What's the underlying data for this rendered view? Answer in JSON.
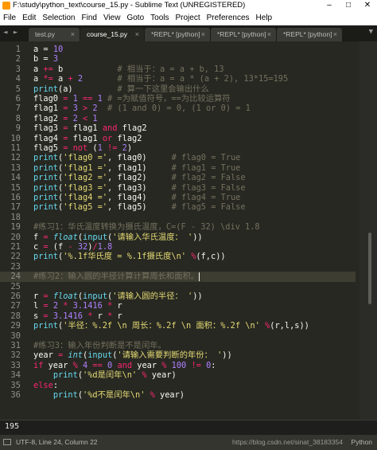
{
  "titlebar": {
    "text": "F:\\study\\python_text\\course_15.py - Sublime Text (UNREGISTERED)",
    "min": "–",
    "max": "□",
    "close": "✕"
  },
  "menu": [
    "File",
    "Edit",
    "Selection",
    "Find",
    "View",
    "Goto",
    "Tools",
    "Project",
    "Preferences",
    "Help"
  ],
  "tabs": [
    {
      "label": "test.py",
      "close": "×"
    },
    {
      "label": "course_15.py",
      "close": "×"
    },
    {
      "label": "*REPL* [python]",
      "close": "×"
    },
    {
      "label": "*REPL* [python]",
      "close": "×"
    },
    {
      "label": "*REPL* [python]",
      "close": "×"
    }
  ],
  "nav_arrows": "◄ ►",
  "dropdown": "▼",
  "code_lines": [
    [
      [
        "a = ",
        ""
      ],
      [
        "10",
        "n"
      ]
    ],
    [
      [
        "b = ",
        ""
      ],
      [
        "3",
        "n"
      ]
    ],
    [
      [
        "a ",
        ""
      ],
      [
        "+=",
        "k"
      ],
      [
        " b           ",
        ""
      ],
      [
        "# 相当于：a = a + b, 13",
        "c"
      ]
    ],
    [
      [
        "a ",
        ""
      ],
      [
        "*=",
        "k"
      ],
      [
        " a ",
        ""
      ],
      [
        "+",
        "k"
      ],
      [
        " ",
        ""
      ],
      [
        "2",
        "n"
      ],
      [
        "       ",
        ""
      ],
      [
        "# 相当于：a = a * (a + 2), 13*15=195",
        "c"
      ]
    ],
    [
      [
        "print",
        "b"
      ],
      [
        "(a)         ",
        ""
      ],
      [
        "# 算一下这里会输出什么",
        "c"
      ]
    ],
    [
      [
        "flag0 ",
        ""
      ],
      [
        "=",
        "k"
      ],
      [
        " ",
        ""
      ],
      [
        "1",
        "n"
      ],
      [
        " ",
        ""
      ],
      [
        "==",
        "k"
      ],
      [
        " ",
        ""
      ],
      [
        "1",
        "n"
      ],
      [
        " ",
        ""
      ],
      [
        "# =为赋值符号，==为比较运算符",
        "c"
      ]
    ],
    [
      [
        "flag1 ",
        ""
      ],
      [
        "=",
        "k"
      ],
      [
        " ",
        ""
      ],
      [
        "3",
        "n"
      ],
      [
        " ",
        ""
      ],
      [
        ">",
        "k"
      ],
      [
        " ",
        ""
      ],
      [
        "2",
        "n"
      ],
      [
        "  ",
        ""
      ],
      [
        "# (1 and 0) = 0, (1 or 0) = 1",
        "c"
      ]
    ],
    [
      [
        "flag2 ",
        ""
      ],
      [
        "=",
        "k"
      ],
      [
        " ",
        ""
      ],
      [
        "2",
        "n"
      ],
      [
        " ",
        ""
      ],
      [
        "<",
        "k"
      ],
      [
        " ",
        ""
      ],
      [
        "1",
        "n"
      ]
    ],
    [
      [
        "flag3 ",
        ""
      ],
      [
        "=",
        "k"
      ],
      [
        " flag1 ",
        ""
      ],
      [
        "and",
        "k"
      ],
      [
        " flag2",
        ""
      ]
    ],
    [
      [
        "flag4 ",
        ""
      ],
      [
        "=",
        "k"
      ],
      [
        " flag1 ",
        ""
      ],
      [
        "or",
        "k"
      ],
      [
        " flag2",
        ""
      ]
    ],
    [
      [
        "flag5 ",
        ""
      ],
      [
        "=",
        "k"
      ],
      [
        " ",
        ""
      ],
      [
        "not",
        "k"
      ],
      [
        " (",
        ""
      ],
      [
        "1",
        "n"
      ],
      [
        " ",
        ""
      ],
      [
        "!=",
        "k"
      ],
      [
        " ",
        ""
      ],
      [
        "2",
        "n"
      ],
      [
        ")",
        ""
      ]
    ],
    [
      [
        "print",
        "b"
      ],
      [
        "(",
        ""
      ],
      [
        "'flag0 ='",
        "s"
      ],
      [
        ", flag0)     ",
        ""
      ],
      [
        "# flag0 = True",
        "c"
      ]
    ],
    [
      [
        "print",
        "b"
      ],
      [
        "(",
        ""
      ],
      [
        "'flag1 ='",
        "s"
      ],
      [
        ", flag1)     ",
        ""
      ],
      [
        "# flag1 = True",
        "c"
      ]
    ],
    [
      [
        "print",
        "b"
      ],
      [
        "(",
        ""
      ],
      [
        "'flag2 ='",
        "s"
      ],
      [
        ", flag2)     ",
        ""
      ],
      [
        "# flag2 = False",
        "c"
      ]
    ],
    [
      [
        "print",
        "b"
      ],
      [
        "(",
        ""
      ],
      [
        "'flag3 ='",
        "s"
      ],
      [
        ", flag3)     ",
        ""
      ],
      [
        "# flag3 = False",
        "c"
      ]
    ],
    [
      [
        "print",
        "b"
      ],
      [
        "(",
        ""
      ],
      [
        "'flag4 ='",
        "s"
      ],
      [
        ", flag4)     ",
        ""
      ],
      [
        "# flag4 = True",
        "c"
      ]
    ],
    [
      [
        "print",
        "b"
      ],
      [
        "(",
        ""
      ],
      [
        "'flag5 ='",
        "s"
      ],
      [
        ", flag5)     ",
        ""
      ],
      [
        "# flag5 = False",
        "c"
      ]
    ],
    [],
    [
      [
        "#练习1：华氏温度转换为摄氏温度，C=(F - 32) \\div 1.8",
        "c"
      ]
    ],
    [
      [
        "f ",
        ""
      ],
      [
        "=",
        "k"
      ],
      [
        " ",
        ""
      ],
      [
        "float",
        "f"
      ],
      [
        "(",
        ""
      ],
      [
        "input",
        "b"
      ],
      [
        "(",
        ""
      ],
      [
        "'请输入华氏温度： '",
        "s"
      ],
      [
        "))",
        ""
      ]
    ],
    [
      [
        "c ",
        ""
      ],
      [
        "=",
        "k"
      ],
      [
        " (f ",
        ""
      ],
      [
        "-",
        "k"
      ],
      [
        " ",
        ""
      ],
      [
        "32",
        "n"
      ],
      [
        ")",
        ""
      ],
      [
        "/",
        "k"
      ],
      [
        "1.8",
        "n"
      ]
    ],
    [
      [
        "print",
        "b"
      ],
      [
        "(",
        ""
      ],
      [
        "'%.1f华氏度 = %.1f摄氏度\\n'",
        "s"
      ],
      [
        " ",
        ""
      ],
      [
        "%",
        "k"
      ],
      [
        "(f,c))",
        ""
      ]
    ],
    [],
    [
      [
        "#练习2：输入圆的半径计算计算周长和面积。",
        "c"
      ]
    ],
    [],
    [
      [
        "r ",
        ""
      ],
      [
        "=",
        "k"
      ],
      [
        " ",
        ""
      ],
      [
        "float",
        "f"
      ],
      [
        "(",
        ""
      ],
      [
        "input",
        "b"
      ],
      [
        "(",
        ""
      ],
      [
        "'请输入圆的半径： '",
        "s"
      ],
      [
        "))",
        ""
      ]
    ],
    [
      [
        "l ",
        ""
      ],
      [
        "=",
        "k"
      ],
      [
        " ",
        ""
      ],
      [
        "2",
        "n"
      ],
      [
        " ",
        ""
      ],
      [
        "*",
        "k"
      ],
      [
        " ",
        ""
      ],
      [
        "3.1416",
        "n"
      ],
      [
        " ",
        ""
      ],
      [
        "*",
        "k"
      ],
      [
        " r",
        ""
      ]
    ],
    [
      [
        "s ",
        ""
      ],
      [
        "=",
        "k"
      ],
      [
        " ",
        ""
      ],
      [
        "3.1416",
        "n"
      ],
      [
        " ",
        ""
      ],
      [
        "*",
        "k"
      ],
      [
        " r ",
        ""
      ],
      [
        "*",
        "k"
      ],
      [
        " r",
        ""
      ]
    ],
    [
      [
        "print",
        "b"
      ],
      [
        "(",
        ""
      ],
      [
        "'半径：%.2f \\n 周长：%.2f \\n 面积：%.2f \\n'",
        "s"
      ],
      [
        " ",
        ""
      ],
      [
        "%",
        "k"
      ],
      [
        "(r,l,s))",
        ""
      ]
    ],
    [],
    [
      [
        "#练习3：输入年份判断是不是闰年。",
        "c"
      ]
    ],
    [
      [
        "year ",
        ""
      ],
      [
        "=",
        "k"
      ],
      [
        " ",
        ""
      ],
      [
        "int",
        "f"
      ],
      [
        "(",
        ""
      ],
      [
        "input",
        "b"
      ],
      [
        "(",
        ""
      ],
      [
        "'请输入需要判断的年份： '",
        "s"
      ],
      [
        "))",
        ""
      ]
    ],
    [
      [
        "if",
        "k"
      ],
      [
        " year ",
        ""
      ],
      [
        "%",
        "k"
      ],
      [
        " ",
        ""
      ],
      [
        "4",
        "n"
      ],
      [
        " ",
        ""
      ],
      [
        "==",
        "k"
      ],
      [
        " ",
        ""
      ],
      [
        "0",
        "n"
      ],
      [
        " ",
        ""
      ],
      [
        "and",
        "k"
      ],
      [
        " year ",
        ""
      ],
      [
        "%",
        "k"
      ],
      [
        " ",
        ""
      ],
      [
        "100",
        "n"
      ],
      [
        " ",
        ""
      ],
      [
        "!=",
        "k"
      ],
      [
        " ",
        ""
      ],
      [
        "0",
        "n"
      ],
      [
        ":",
        ""
      ]
    ],
    [
      [
        "    ",
        ""
      ],
      [
        "print",
        "b"
      ],
      [
        "(",
        ""
      ],
      [
        "'%d是闰年\\n'",
        "s"
      ],
      [
        " ",
        ""
      ],
      [
        "%",
        "k"
      ],
      [
        " year)",
        ""
      ]
    ],
    [
      [
        "else",
        "k"
      ],
      [
        ":",
        ""
      ]
    ],
    [
      [
        "    ",
        ""
      ],
      [
        "print",
        "b"
      ],
      [
        "(",
        ""
      ],
      [
        "'%d不是闰年\\n'",
        "s"
      ],
      [
        " ",
        ""
      ],
      [
        "%",
        "k"
      ],
      [
        " year)",
        ""
      ]
    ]
  ],
  "current_line": 24,
  "console": {
    "output": "195"
  },
  "status": {
    "position": "UTF-8, Line 24, Column 22",
    "watermark": "https://blog.csdn.net/sinat_38183354",
    "syntax": "Python"
  }
}
